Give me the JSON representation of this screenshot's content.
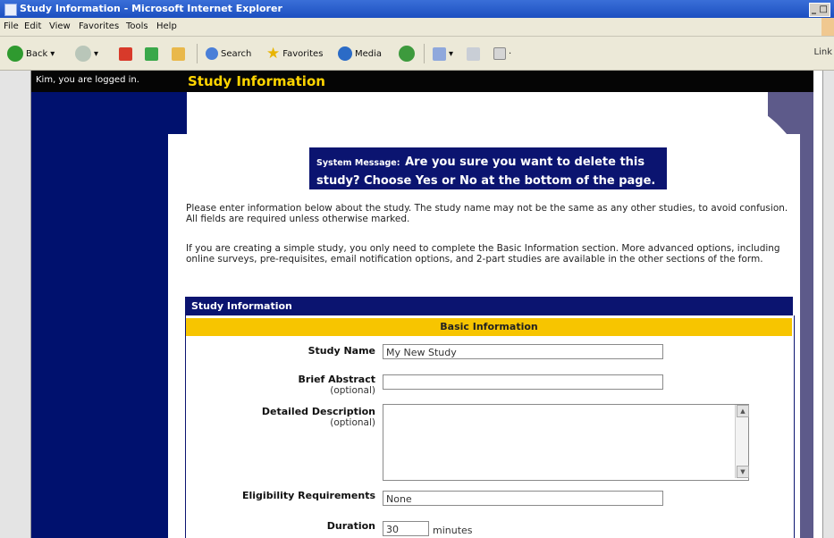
{
  "window": {
    "title": "Study Information - Microsoft Internet Explorer"
  },
  "menu": [
    "File",
    "Edit",
    "View",
    "Favorites",
    "Tools",
    "Help"
  ],
  "toolbar": {
    "back": "Back",
    "search": "Search",
    "favorites": "Favorites",
    "media": "Media",
    "links": "Link"
  },
  "page": {
    "logged_in": "Kim, you are logged in.",
    "title": "Study Information"
  },
  "system_message": {
    "label": "System Message:",
    "text": "Are you sure you want to delete this study? Choose Yes or No at the bottom of the page."
  },
  "intro": [
    "Please enter information below about the study. The study name may not be the same as any other studies, to avoid confusion. All fields are required unless otherwise marked.",
    "If you are creating a simple study, you only need to complete the Basic Information section. More advanced options, including online surveys, pre-requisites, email notification options, and 2-part studies are available in the other sections of the form."
  ],
  "form": {
    "section_title": "Study Information",
    "subsection_title": "Basic Information",
    "study_name": {
      "label": "Study Name",
      "value": "My New Study"
    },
    "brief_abstract": {
      "label": "Brief Abstract",
      "note": "(optional)",
      "value": ""
    },
    "detailed_description": {
      "label": "Detailed Description",
      "note": "(optional)",
      "value": ""
    },
    "eligibility": {
      "label": "Eligibility Requirements",
      "value": "None"
    },
    "duration": {
      "label": "Duration",
      "value": "30",
      "unit": "minutes"
    }
  },
  "colors": {
    "nav_blue": "#00116e",
    "header_navy": "#0b1470",
    "title_yellow": "#ffd500",
    "section_gold": "#f7c500"
  }
}
